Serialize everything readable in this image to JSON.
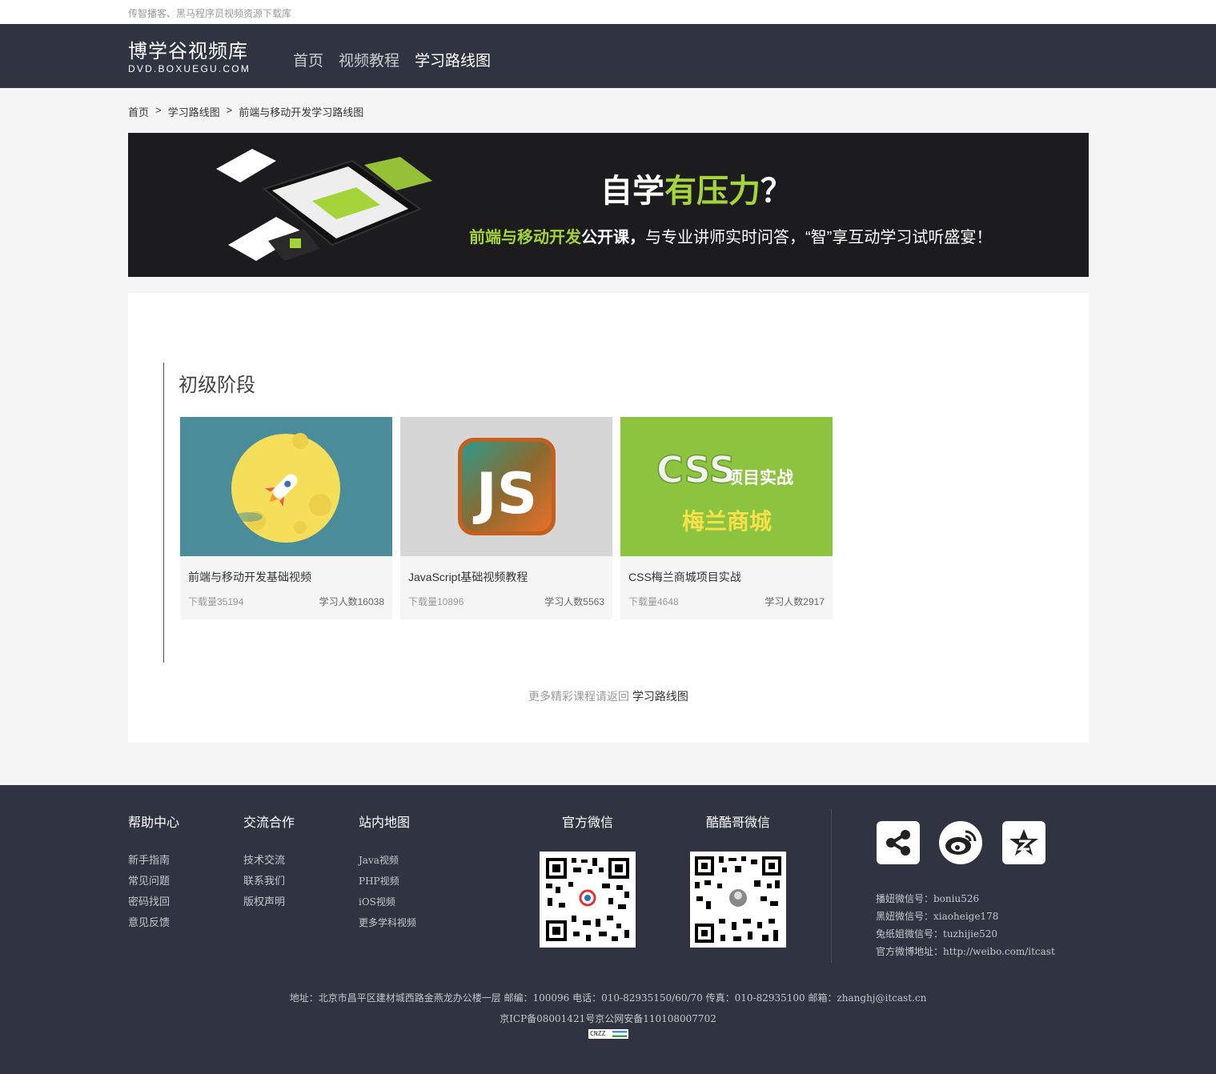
{
  "topbar": {
    "text": "传智播客、黑马程序员视频资源下载库"
  },
  "header": {
    "logo_title": "博学谷视频库",
    "logo_sub": "DVD.BOXUEGU.COM",
    "nav": [
      {
        "label": "首页",
        "active": false
      },
      {
        "label": "视频教程",
        "active": false
      },
      {
        "label": "学习路线图",
        "active": true
      }
    ]
  },
  "breadcrumb": {
    "items": [
      "首页",
      "学习路线图",
      "前端与移动开发学习路线图"
    ],
    "separator": ">"
  },
  "banner": {
    "headline_part1": "自学",
    "headline_part2": "有压力",
    "headline_part3": "？",
    "sub_highlight": "前端与移动开发",
    "sub_bold": "公开课，",
    "sub_rest": "与专业讲师实时问答，“智”享互动学习试听盛宴！",
    "accent_color": "#a4d33a"
  },
  "stage": {
    "title": "初级阶段",
    "courses": [
      {
        "name": "前端与移动开发基础视频",
        "downloads_label": "下载量35194",
        "students_label": "学习人数16038",
        "thumb_color": "#4a8c99",
        "thumb_icon": "rocket-moon-icon"
      },
      {
        "name": "JavaScript基础视频教程",
        "downloads_label": "下载量10896",
        "students_label": "学习人数5563",
        "thumb_color": "#d6d6d6",
        "thumb_icon": "js-logo-icon",
        "thumb_text": "JS"
      },
      {
        "name": "CSS梅兰商城项目实战",
        "downloads_label": "下载量4648",
        "students_label": "学习人数2917",
        "thumb_color": "#8cc43f",
        "thumb_icon": "css-project-icon",
        "thumb_text1": "CSS",
        "thumb_text2": "项目实战",
        "thumb_text3": "梅兰商城"
      }
    ]
  },
  "more": {
    "prefix": "更多精彩课程请返回",
    "link": "学习路线图"
  },
  "footer": {
    "help": {
      "title": "帮助中心",
      "items": [
        "新手指南",
        "常见问题",
        "密码找回",
        "意见反馈"
      ]
    },
    "coop": {
      "title": "交流合作",
      "items": [
        "技术交流",
        "联系我们",
        "版权声明"
      ]
    },
    "sitemap": {
      "title": "站内地图",
      "items": [
        "Java视频",
        "PHP视频",
        "iOS视频",
        "更多学科视频"
      ]
    },
    "wechat_official": {
      "title": "官方微信"
    },
    "wechat_kuku": {
      "title": "酷酷哥微信"
    },
    "social": [
      "share-icon",
      "weibo-icon",
      "qzone-icon"
    ],
    "contacts": [
      "播妞微信号：boniu526",
      "黑妞微信号：xiaoheige178",
      "兔纸姐微信号：tuzhijie520",
      "官方微博地址：http://weibo.com/itcast"
    ],
    "address": "地址：北京市昌平区建材城西路金燕龙办公楼一层  邮编：100096 电话：010-82935150/60/70 传真：010-82935100 邮箱：zhanghj@itcast.cn",
    "icp": "京ICP备08001421号京公网安备110108007702",
    "badge": "CNZZ"
  }
}
